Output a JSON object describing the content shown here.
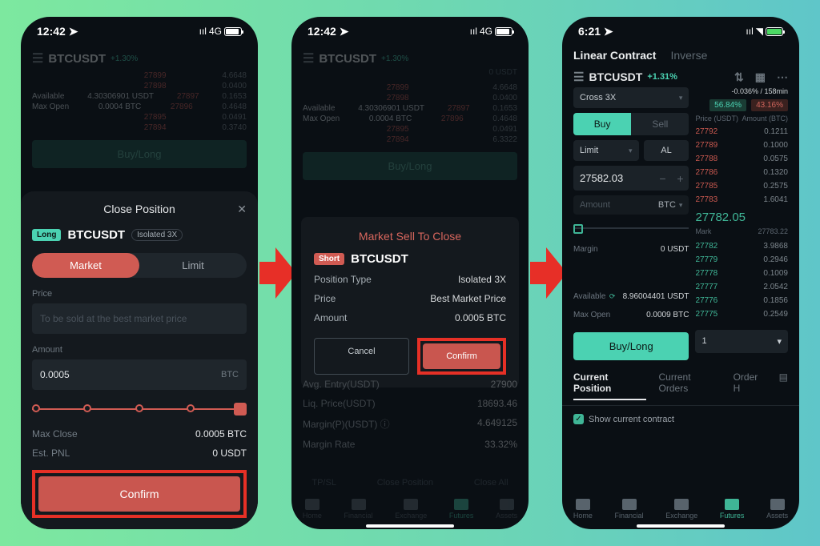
{
  "phone1": {
    "time": "12:42",
    "network": "4G",
    "header": {
      "symbol": "BTCUSDT",
      "change": "+1.30%"
    },
    "bg_rows": [
      {
        "k": "",
        "v": "",
        "p": "27899",
        "a": "4.6648"
      },
      {
        "k": "",
        "v": "",
        "p": "27898",
        "a": "0.0400"
      },
      {
        "k": "Available",
        "v": "4.30306901 USDT",
        "p": "27897",
        "a": "0.1653"
      },
      {
        "k": "Max Open",
        "v": "0.0004 BTC",
        "p": "27896",
        "a": "0.4648"
      },
      {
        "k": "",
        "v": "",
        "p": "27895",
        "a": "0.0491"
      },
      {
        "k": "",
        "v": "",
        "p": "27894",
        "a": "0.3740"
      }
    ],
    "bg_buy": "Buy/Long",
    "modal": {
      "title": "Close Position",
      "badge": "Long",
      "symbol": "BTCUSDT",
      "isolated": "Isolated 3X",
      "tab_market": "Market",
      "tab_limit": "Limit",
      "price_label": "Price",
      "price_placeholder": "To be sold at the best market price",
      "amount_label": "Amount",
      "amount_value": "0.0005",
      "amount_unit": "BTC",
      "max_close_label": "Max Close",
      "max_close_value": "0.0005 BTC",
      "est_pnl_label": "Est. PNL",
      "est_pnl_value": "0 USDT",
      "confirm": "Confirm"
    }
  },
  "phone2": {
    "time": "12:42",
    "network": "4G",
    "header": {
      "symbol": "BTCUSDT",
      "change": "+1.30%"
    },
    "bg_usdt": "0 USDT",
    "bg_rows": [
      {
        "p": "27899",
        "a": "4.6648"
      },
      {
        "p": "27898",
        "a": "0.0400"
      },
      {
        "p": "27897",
        "a": "0.1653"
      },
      {
        "p": "27896",
        "a": "0.4648"
      },
      {
        "p": "27895",
        "a": "0.0491"
      },
      {
        "p": "27894",
        "a": "6.3322"
      }
    ],
    "bg_available_k": "Available",
    "bg_available_v": "4.30306901 USDT",
    "bg_maxopen_k": "Max Open",
    "bg_maxopen_v": "0.0004 BTC",
    "bg_buy": "Buy/Long",
    "below": [
      {
        "k": "Avg. Entry(USDT)",
        "v": "27900"
      },
      {
        "k": "Liq. Price(USDT)",
        "v": "18693.46"
      },
      {
        "k": "Margin(P)(USDT) ⓘ",
        "v": "4.649125"
      },
      {
        "k": "Margin Rate",
        "v": "33.32%"
      }
    ],
    "sec_btns": [
      "TP/SL",
      "Close Position",
      "Close All"
    ],
    "dialog": {
      "title": "Market Sell To Close",
      "badge": "Short",
      "symbol": "BTCUSDT",
      "type_label": "Position Type",
      "type_value": "Isolated 3X",
      "price_label": "Price",
      "price_value": "Best Market Price",
      "amount_label": "Amount",
      "amount_value": "0.0005 BTC",
      "cancel": "Cancel",
      "confirm": "Confirm"
    },
    "nav": [
      "Home",
      "Financial",
      "Exchange",
      "Futures",
      "Assets"
    ]
  },
  "phone3": {
    "time": "6:21",
    "tabs": {
      "linear": "Linear Contract",
      "inverse": "Inverse"
    },
    "pair": {
      "symbol": "BTCUSDT",
      "change": "+1.31%"
    },
    "cross": "Cross  3X",
    "delta": "-0.036% / 158min",
    "rate_long": "56.84%",
    "rate_short": "43.16%",
    "buy": "Buy",
    "sell": "Sell",
    "limit": "Limit",
    "al": "AL",
    "price_input": "27582.03",
    "amount_label": "Amount",
    "amount_currency": "BTC",
    "margin_label": "Margin",
    "margin_value": "0 USDT",
    "available_label": "Available",
    "available_value": "8.96004401 USDT",
    "maxopen_label": "Max Open",
    "maxopen_value": "0.0009 BTC",
    "buy_btn": "Buy/Long",
    "qty": "1",
    "ob_hdr_price": "Price (USDT)",
    "ob_hdr_amt": "Amount (BTC)",
    "asks": [
      {
        "p": "27792",
        "a": "0.1211"
      },
      {
        "p": "27789",
        "a": "0.1000"
      },
      {
        "p": "27788",
        "a": "0.0575"
      },
      {
        "p": "27786",
        "a": "0.1320"
      },
      {
        "p": "27785",
        "a": "0.2575"
      },
      {
        "p": "27783",
        "a": "1.6041"
      }
    ],
    "mark_price": "27782.05",
    "mark_label": "Mark",
    "mark_value": "27783.22",
    "bids": [
      {
        "p": "27782",
        "a": "3.9868"
      },
      {
        "p": "27779",
        "a": "0.2946"
      },
      {
        "p": "27778",
        "a": "0.1009"
      },
      {
        "p": "27777",
        "a": "2.0542"
      },
      {
        "p": "27776",
        "a": "0.1856"
      },
      {
        "p": "27775",
        "a": "0.2549"
      }
    ],
    "tabs2": {
      "cp": "Current Position",
      "co": "Current Orders",
      "oh": "Order H"
    },
    "show_contract": "Show current contract",
    "nav": [
      "Home",
      "Financial",
      "Exchange",
      "Futures",
      "Assets"
    ]
  }
}
